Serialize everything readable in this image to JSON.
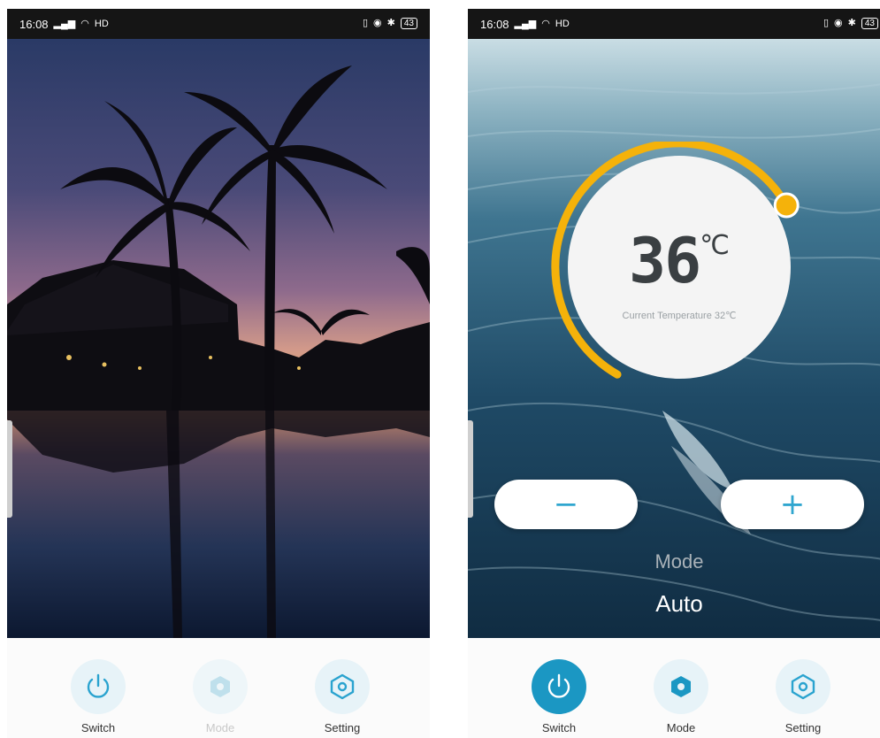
{
  "left_screen": {
    "status_bar": {
      "time": "16:08",
      "signal": "4G",
      "network": "HD",
      "battery": "43"
    },
    "nav": [
      {
        "label": "Switch",
        "icon": "power-icon",
        "state": "enabled"
      },
      {
        "label": "Mode",
        "icon": "hexagon-icon",
        "state": "disabled"
      },
      {
        "label": "Setting",
        "icon": "hex-gear-icon",
        "state": "enabled"
      }
    ]
  },
  "right_screen": {
    "status_bar": {
      "time": "16:08",
      "signal": "4G",
      "network": "HD",
      "battery": "43"
    },
    "thermostat": {
      "set_temperature": "36",
      "unit": "℃",
      "current_label": "Current Temperature 32℃",
      "dial_fraction": 0.7
    },
    "buttons": {
      "decrease": "−",
      "increase": "+"
    },
    "mode": {
      "caption": "Mode",
      "value": "Auto"
    },
    "nav": [
      {
        "label": "Switch",
        "icon": "power-icon",
        "state": "active"
      },
      {
        "label": "Mode",
        "icon": "hexagon-icon",
        "state": "enabled"
      },
      {
        "label": "Setting",
        "icon": "hex-gear-icon",
        "state": "enabled"
      }
    ]
  },
  "colors": {
    "accent": "#1b97c3",
    "dial_arc": "#f5b20a",
    "dial_knob": "#f5b20a",
    "button_text": "#30a6cf"
  }
}
